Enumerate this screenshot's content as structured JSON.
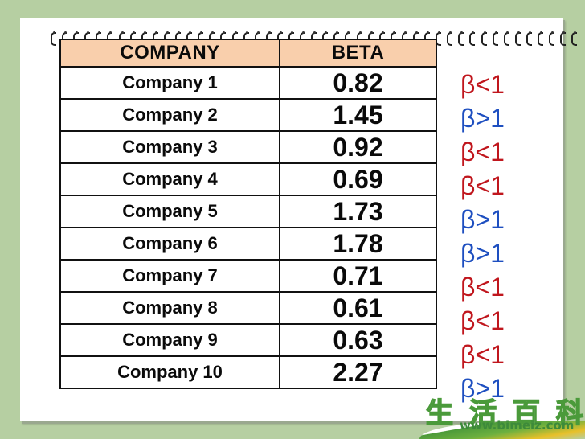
{
  "table": {
    "headers": {
      "company": "COMPANY",
      "beta": "BETA"
    },
    "rows": [
      {
        "company": "Company 1",
        "beta": "0.82",
        "indicator": "β<1",
        "type": "low"
      },
      {
        "company": "Company 2",
        "beta": "1.45",
        "indicator": "β>1",
        "type": "high"
      },
      {
        "company": "Company 3",
        "beta": "0.92",
        "indicator": "β<1",
        "type": "low"
      },
      {
        "company": "Company 4",
        "beta": "0.69",
        "indicator": "β<1",
        "type": "low"
      },
      {
        "company": "Company 5",
        "beta": "1.73",
        "indicator": "β>1",
        "type": "high"
      },
      {
        "company": "Company 6",
        "beta": "1.78",
        "indicator": "β>1",
        "type": "high"
      },
      {
        "company": "Company 7",
        "beta": "0.71",
        "indicator": "β<1",
        "type": "low"
      },
      {
        "company": "Company 8",
        "beta": "0.61",
        "indicator": "β<1",
        "type": "low"
      },
      {
        "company": "Company 9",
        "beta": "0.63",
        "indicator": "β<1",
        "type": "low"
      },
      {
        "company": "Company 10",
        "beta": "2.27",
        "indicator": "β>1",
        "type": "high"
      }
    ]
  },
  "colors": {
    "background": "#b6cfa2",
    "header_fill": "#f9cfac",
    "low_beta": "#c0161d",
    "high_beta": "#1e4fc0"
  },
  "watermark": {
    "chars": [
      "生",
      "活",
      "百",
      "科"
    ],
    "url": "www.bimeiz.com"
  },
  "icons": {
    "binding": "spiral-binding-icon"
  }
}
